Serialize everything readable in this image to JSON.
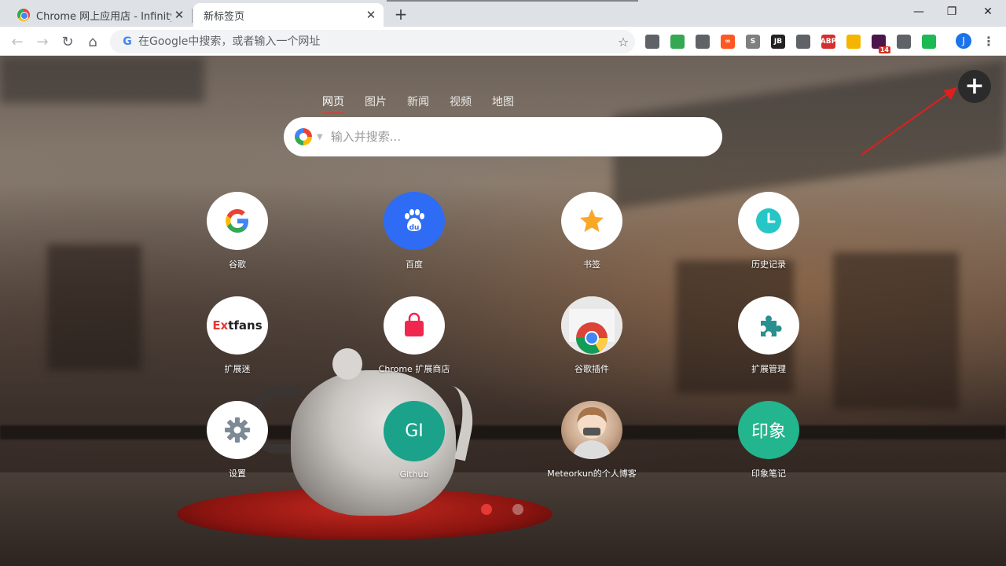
{
  "tabs": [
    {
      "title": "Chrome 网上应用店 - Infinity新",
      "close": "✕",
      "favicon": "chrome-store-icon"
    },
    {
      "title": "新标签页",
      "close": "✕"
    }
  ],
  "newtab": "+",
  "window_controls": {
    "minimize": "—",
    "maximize": "❐",
    "close": "✕"
  },
  "toolbar": {
    "back": "←",
    "forward": "→",
    "reload": "↻",
    "home": "⌂",
    "omnibox_g": "G",
    "omnibox_placeholder": "在Google中搜索，或者输入一个网址",
    "bookmark_star": "☆",
    "profile_initial": "J",
    "menu": "⋮"
  },
  "extensions": [
    {
      "name": "vimium-icon",
      "label": "",
      "color": "#5f6368"
    },
    {
      "name": "colorful-ext-icon",
      "label": "",
      "color": "#34a853"
    },
    {
      "name": "sync-ext-icon",
      "label": "",
      "color": "#5f6368"
    },
    {
      "name": "infinity-ext-icon",
      "label": "∞",
      "color": "#ff5722"
    },
    {
      "name": "s-ext-icon",
      "label": "S",
      "color": "#7f7f7f"
    },
    {
      "name": "jb-ext-icon",
      "label": "JB",
      "color": "#222222"
    },
    {
      "name": "tabs-ext-icon",
      "label": "",
      "color": "#5f6368"
    },
    {
      "name": "adblock-plus-icon",
      "label": "ABP",
      "color": "#d32f2f"
    },
    {
      "name": "shield-ext-icon",
      "label": "",
      "color": "#f4b400"
    },
    {
      "name": "slack-ext-icon",
      "label": "",
      "color": "#4a154b",
      "badge": "14"
    },
    {
      "name": "screenshot-ext-icon",
      "label": "",
      "color": "#5f6368"
    },
    {
      "name": "audio-ext-icon",
      "label": "",
      "color": "#1db954"
    }
  ],
  "search": {
    "tabs": [
      "网页",
      "图片",
      "新闻",
      "视频",
      "地图"
    ],
    "active_tab": "网页",
    "placeholder": "输入并搜索...",
    "caret": "▼"
  },
  "add_button": "+",
  "shortcuts": [
    {
      "label": "谷歌",
      "icon": "google-icon"
    },
    {
      "label": "百度",
      "icon": "baidu-icon"
    },
    {
      "label": "书签",
      "icon": "star-icon"
    },
    {
      "label": "历史记录",
      "icon": "clock-icon"
    },
    {
      "label": "扩展迷",
      "icon": "extfans-logo",
      "logo_text": "Extfans"
    },
    {
      "label": "Chrome 扩展商店",
      "icon": "shopping-bag-icon"
    },
    {
      "label": "谷歌插件",
      "icon": "chrome-webstore-icon"
    },
    {
      "label": "扩展管理",
      "icon": "puzzle-icon"
    },
    {
      "label": "设置",
      "icon": "gear-icon"
    },
    {
      "label": "Github",
      "icon": "github-text-icon",
      "icon_text": "GI"
    },
    {
      "label": "Meteorkun的个人博客",
      "icon": "avatar-icon"
    },
    {
      "label": "印象笔记",
      "icon": "yinxiang-text-icon",
      "icon_text": "印象"
    }
  ],
  "pagination": {
    "pages": 2,
    "active": 1
  },
  "colors": {
    "accent_red": "#e53935",
    "baidu_blue": "#2e6cf6",
    "github_green": "#1ba28a",
    "yinxiang_green": "#22b58e",
    "star_yellow": "#f9a825",
    "clock_teal": "#26c6c6",
    "puzzle_teal": "#2a8f8f",
    "settings_gray": "#7d8a96",
    "bag_red": "#f02850"
  }
}
